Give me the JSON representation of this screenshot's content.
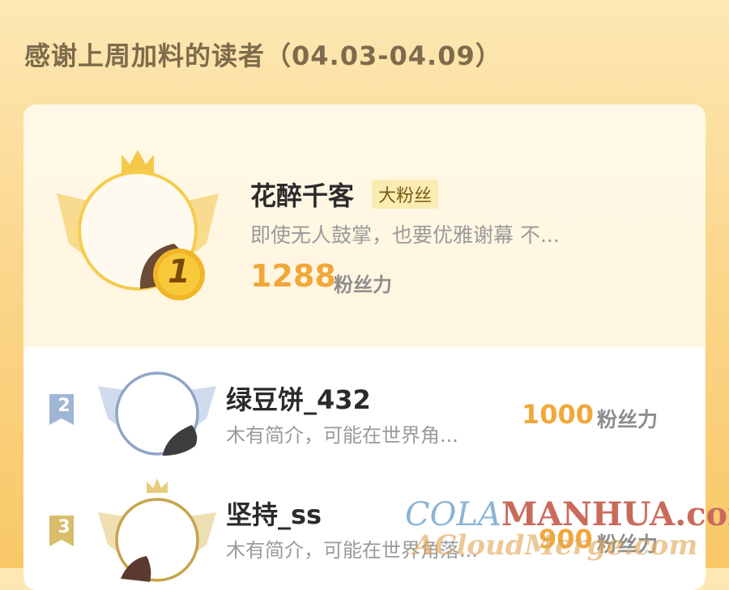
{
  "header": {
    "title": "感谢上周加料的读者（04.03-04.09）"
  },
  "top_reader": {
    "rank": "1",
    "name": "花醉千客",
    "badge": "大粉丝",
    "bio": "即使无人鼓掌，也要优雅谢幕 不...",
    "score": "1288",
    "score_unit": "粉丝力"
  },
  "readers": [
    {
      "rank": "2",
      "name": "绿豆饼_432",
      "bio": "木有简介，可能在世界角...",
      "score": "1000",
      "score_unit": "粉丝力"
    },
    {
      "rank": "3",
      "name": "坚持_ss",
      "bio": "木有简介，可能在世界角落...",
      "score": "900",
      "score_unit": "粉丝力"
    }
  ],
  "watermark": {
    "line1_a": "COLA",
    "line1_b": "MANHUA.com",
    "line2": "ACloudMerge.com"
  },
  "colors": {
    "accent": "#f1a73a",
    "gold": "#f3c63d",
    "silver": "#8fa6c7",
    "bronze": "#c7a44a"
  }
}
